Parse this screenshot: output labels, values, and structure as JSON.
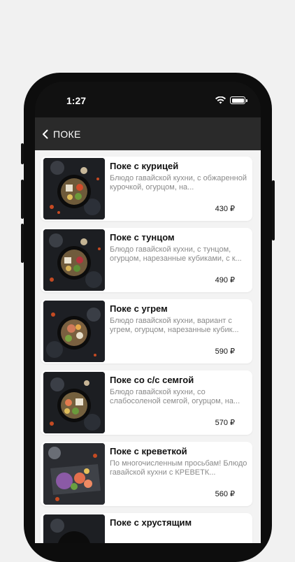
{
  "status_bar": {
    "time": "1:27"
  },
  "navbar": {
    "title": "ПОКЕ",
    "back_icon": "chevron-left-icon"
  },
  "items": [
    {
      "title": "Поке с курицей",
      "description": "Блюдо гавайской кухни, с обжаренной курочкой, огурцом, на...",
      "price": "430 ₽",
      "image": "poke-chicken-photo"
    },
    {
      "title": "Поке с тунцом",
      "description": "Блюдо гавайской кухни, с тунцом, огурцом, нарезанные кубиками, с к...",
      "price": "490 ₽",
      "image": "poke-tuna-photo"
    },
    {
      "title": "Поке с угрем",
      "description": "Блюдо гавайской кухни, вариант с угрем, огурцом, нарезанные кубик...",
      "price": "590 ₽",
      "image": "poke-eel-photo"
    },
    {
      "title": "Поке со с/с семгой",
      "description": "Блюдо гавайской кухни, со слабосоленой семгой, огурцом, на...",
      "price": "570 ₽",
      "image": "poke-salmon-photo"
    },
    {
      "title": "Поке с креветкой",
      "description": "По многочисленным просьбам! Блюдо гавайской кухни с КРЕВЕТК...",
      "price": "560 ₽",
      "image": "poke-shrimp-photo"
    },
    {
      "title": "Поке с хрустящим",
      "description": "",
      "price": "",
      "image": "poke-crispy-photo"
    }
  ],
  "colors": {
    "background": "#f1f1f1",
    "phone": "#0d0d0d",
    "navbar": "#2a2a2a",
    "list_bg": "#f3f3f3",
    "card": "#ffffff"
  }
}
